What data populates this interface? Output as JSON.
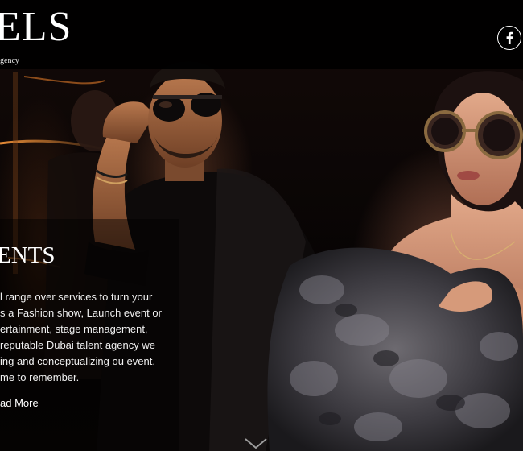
{
  "header": {
    "logo_text": "ELS",
    "tagline": "gency",
    "social": [
      {
        "name": "facebook",
        "icon": "facebook-icon",
        "glyph": "f"
      }
    ]
  },
  "feature": {
    "heading": "ENTS",
    "body_lines": [
      "l range over services to turn your",
      "s a Fashion show, Launch event or",
      "ertainment, stage management,",
      " reputable Dubai talent agency we",
      "ing and conceptualizing ou event,",
      "me to remember."
    ],
    "cta_label": "ad More"
  },
  "colors": {
    "header_background": "#000000",
    "text": "#ffffff",
    "panel_overlay": "#000000"
  }
}
